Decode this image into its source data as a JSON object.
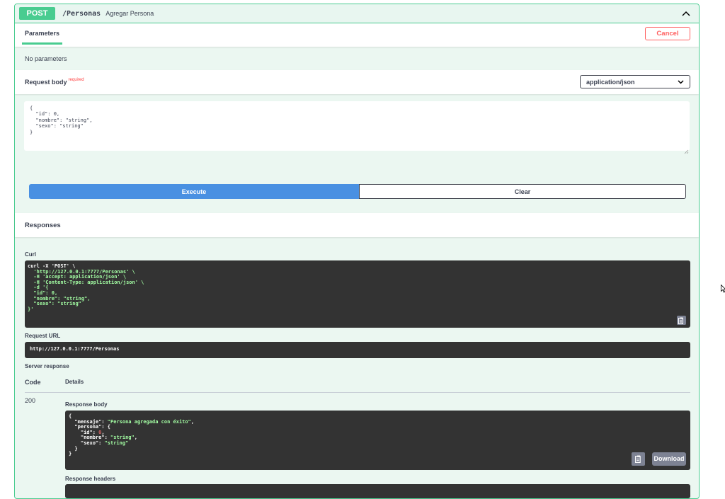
{
  "operation": {
    "method": "POST",
    "path": "/Personas",
    "summary": "Agregar Persona"
  },
  "parameters": {
    "tab_label": "Parameters",
    "cancel_label": "Cancel",
    "empty_text": "No parameters"
  },
  "request_body": {
    "title": "Request body",
    "required_label": "required",
    "content_type": "application/json",
    "editor_lines": [
      "{",
      "  \"id\": 0,",
      "  \"nombre\": \"string\",",
      "  \"sexo\": \"string\"",
      "}"
    ]
  },
  "actions": {
    "execute_label": "Execute",
    "clear_label": "Clear"
  },
  "responses": {
    "title": "Responses",
    "curl_label": "Curl",
    "curl": {
      "l1": "curl -X 'POST' \\",
      "l2": "  'http://127.0.0.1:7777/Personas' \\",
      "l3": "  -H 'accept: application/json' \\",
      "l4": "  -H 'Content-Type: application/json' \\",
      "l5": "  -d '{",
      "l6a": "  \"id\": ",
      "l6b": "0",
      "l6c": ",",
      "l7a": "  \"nombre\": ",
      "l7b": "\"string\"",
      "l7c": ",",
      "l8a": "  \"sexo\": ",
      "l8b": "\"string\"",
      "l9": "}'"
    },
    "request_url_label": "Request URL",
    "request_url": "http://127.0.0.1:7777/Personas",
    "server_response_label": "Server response",
    "col_code": "Code",
    "col_details": "Details",
    "code": "200",
    "response_body_label": "Response body",
    "response_body": {
      "l1": "{",
      "l2a": "  \"mensaje\": ",
      "l2b": "\"Persona agregada con éxito\"",
      "l2c": ",",
      "l3": "  \"persona\": {",
      "l4a": "    \"id\": ",
      "l4b": "0",
      "l4c": ",",
      "l5a": "    \"nombre\": ",
      "l5b": "\"string\"",
      "l5c": ",",
      "l6a": "    \"sexo\": ",
      "l6b": "\"string\"",
      "l7": "  }",
      "l8": "}"
    },
    "download_label": "Download",
    "response_headers_label": "Response headers"
  },
  "colors": {
    "post_green": "#49cc90",
    "execute_blue": "#4990e2",
    "cancel_red": "#ff6060",
    "code_bg": "#333333"
  },
  "icons": [
    "chevron-up-icon",
    "chevron-down-icon",
    "copy-icon",
    "cursor-icon"
  ]
}
